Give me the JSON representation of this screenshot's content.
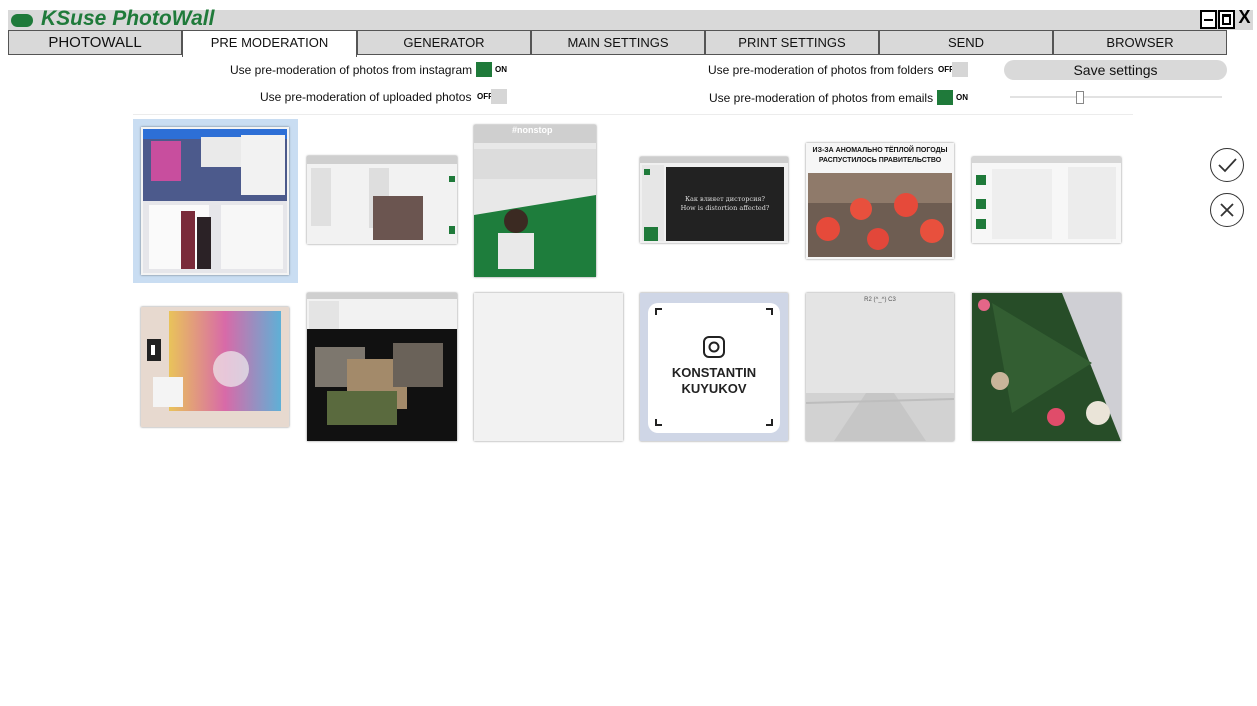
{
  "app": {
    "title": "KSuse PhotoWall"
  },
  "tabs": [
    {
      "label": "PHOTOWALL"
    },
    {
      "label": "PRE MODERATION"
    },
    {
      "label": "GENERATOR"
    },
    {
      "label": "MAIN SETTINGS"
    },
    {
      "label": "PRINT SETTINGS"
    },
    {
      "label": "SEND"
    },
    {
      "label": "BROWSER"
    }
  ],
  "active_tab": "PRE MODERATION",
  "options": {
    "instagram": {
      "label": "Use pre-moderation of photos from instagram",
      "state": "ON"
    },
    "uploaded": {
      "label": "Use pre-moderation of uploaded photos",
      "state": "OFF"
    },
    "folders": {
      "label": "Use pre-moderation of photos from folders",
      "state": "OFF"
    },
    "emails": {
      "label": "Use pre-moderation of photos from emails",
      "state": "ON"
    }
  },
  "save_label": "Save settings",
  "photos": {
    "nonstop_tag": "#nonstop",
    "distortion_text_ru": "Как влияет дисторсия?",
    "distortion_text_en": "How is distortion affected?",
    "news_headline": "ИЗ-ЗА АНОМАЛЬНО ТЁПЛОЙ ПОГОДЫ РАСПУСТИЛОСЬ ПРАВИТЕЛЬСТВО",
    "nametag_first": "KONSTANTIN",
    "nametag_last": "KUYUKOV",
    "fog_caption": "R2 (^_^) C3"
  },
  "colors": {
    "brand_green": "#1f7a3a",
    "selected": "#c9ddf2"
  },
  "icons": {
    "approve": "check-circle-icon",
    "reject": "x-circle-icon"
  }
}
